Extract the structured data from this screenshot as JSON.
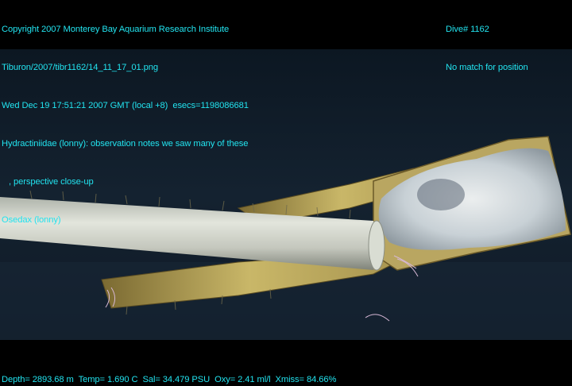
{
  "overlay": {
    "top_left": [
      "Copyright 2007 Monterey Bay Aquarium Research Institute",
      "Tiburon/2007/tibr1162/14_11_17_01.png",
      "Wed Dec 19 17:51:21 2007 GMT (local +8)  esecs=1198086681",
      "Hydractiniidae (lonny): observation notes we saw many of these",
      "   , perspective close-up",
      "Osedax (lonny)"
    ],
    "top_right": [
      "Dive# 1162",
      "No match for position"
    ],
    "bottom": "Depth= 2893.68 m  Temp= 1.690 C  Sal= 34.479 PSU  Oxy= 2.41 ml/l  Xmiss= 84.66%"
  },
  "colors": {
    "overlay_text": "#22e3ef",
    "water": "#0f1a26",
    "bone": "#c9b768",
    "pipe": "#cfd3c9",
    "mat": "#dde4ea"
  }
}
